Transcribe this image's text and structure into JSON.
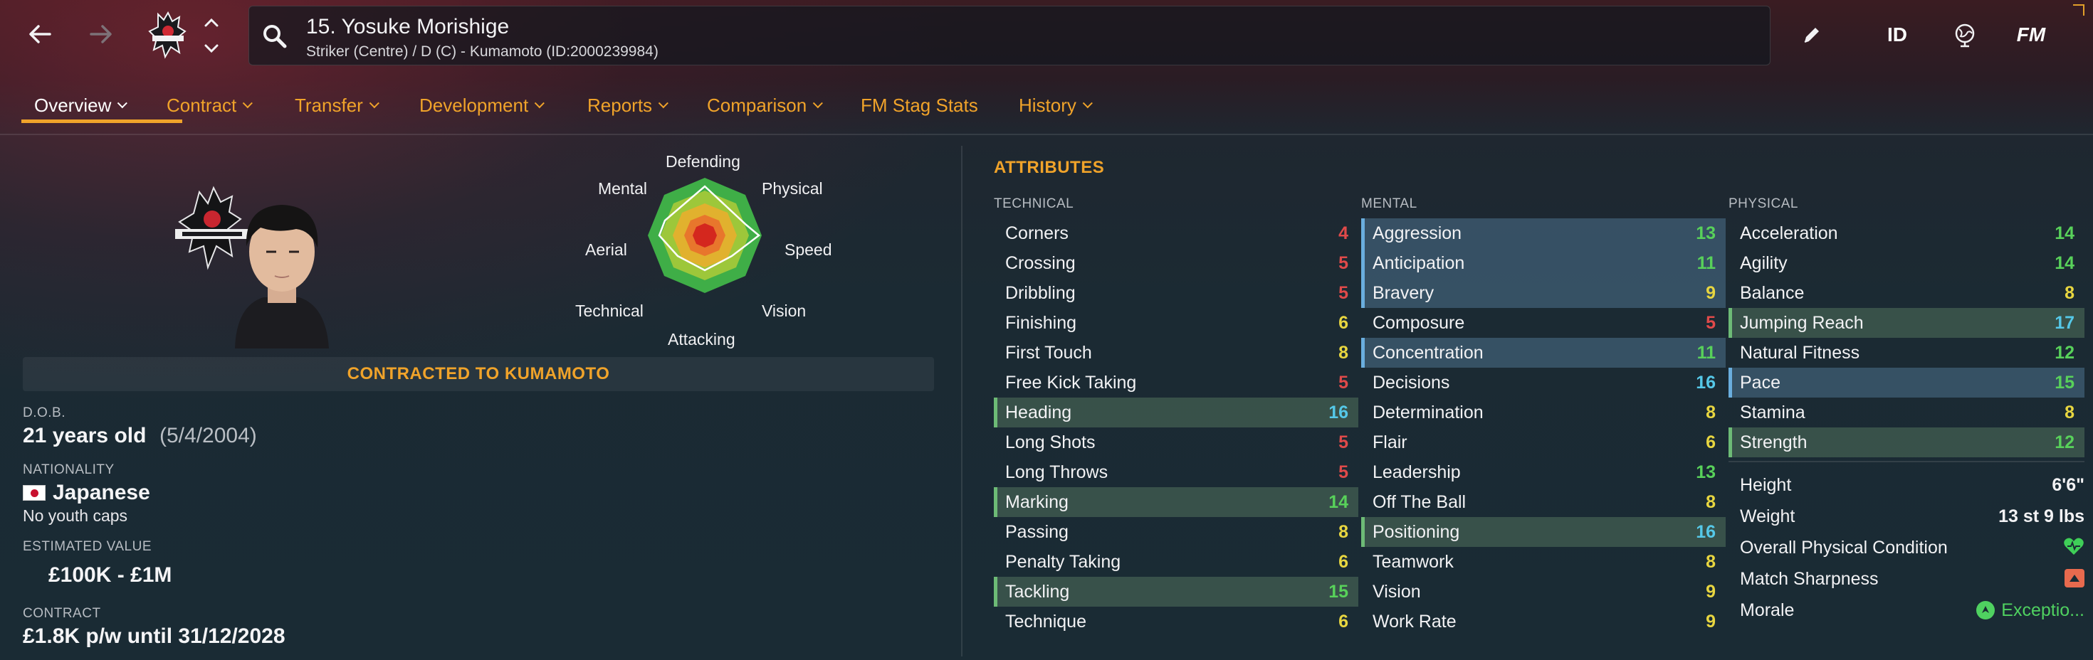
{
  "header": {
    "player_name": "15. Yosuke Morishige",
    "player_subtitle": "Striker (Centre) / D (C) - Kumamoto (ID:2000239984)",
    "id_label": "ID",
    "fm_label": "FM"
  },
  "tabs": [
    {
      "label": "Overview",
      "active": true
    },
    {
      "label": "Contract"
    },
    {
      "label": "Transfer"
    },
    {
      "label": "Development"
    },
    {
      "label": "Reports"
    },
    {
      "label": "Comparison"
    },
    {
      "label": "FM Stag Stats"
    },
    {
      "label": "History"
    }
  ],
  "radar": {
    "labels": {
      "defending": "Defending",
      "physical": "Physical",
      "speed": "Speed",
      "vision": "Vision",
      "attacking": "Attacking",
      "technical": "Technical",
      "aerial": "Aerial",
      "mental": "Mental"
    }
  },
  "profile": {
    "contract_banner": "CONTRACTED TO KUMAMOTO",
    "dob_label": "D.O.B.",
    "age": "21 years old",
    "dob": "(5/4/2004)",
    "nationality_label": "NATIONALITY",
    "nationality": "Japanese",
    "youth_caps": "No youth caps",
    "value_label": "ESTIMATED VALUE",
    "value": "£100K - £1M",
    "contract_label": "CONTRACT",
    "contract": "£1.8K p/w until 31/12/2028"
  },
  "attributes": {
    "title": "ATTRIBUTES",
    "technical": {
      "heading": "TECHNICAL",
      "items": [
        {
          "name": "Corners",
          "value": "4"
        },
        {
          "name": "Crossing",
          "value": "5"
        },
        {
          "name": "Dribbling",
          "value": "5"
        },
        {
          "name": "Finishing",
          "value": "6"
        },
        {
          "name": "First Touch",
          "value": "8"
        },
        {
          "name": "Free Kick Taking",
          "value": "5"
        },
        {
          "name": "Heading",
          "value": "16",
          "hl": "green"
        },
        {
          "name": "Long Shots",
          "value": "5"
        },
        {
          "name": "Long Throws",
          "value": "5"
        },
        {
          "name": "Marking",
          "value": "14",
          "hl": "green"
        },
        {
          "name": "Passing",
          "value": "8"
        },
        {
          "name": "Penalty Taking",
          "value": "6"
        },
        {
          "name": "Tackling",
          "value": "15",
          "hl": "green"
        },
        {
          "name": "Technique",
          "value": "6"
        }
      ]
    },
    "mental": {
      "heading": "MENTAL",
      "items": [
        {
          "name": "Aggression",
          "value": "13",
          "hl": "blue"
        },
        {
          "name": "Anticipation",
          "value": "11",
          "hl": "blue"
        },
        {
          "name": "Bravery",
          "value": "9",
          "hl": "blue"
        },
        {
          "name": "Composure",
          "value": "5"
        },
        {
          "name": "Concentration",
          "value": "11",
          "hl": "blue"
        },
        {
          "name": "Decisions",
          "value": "16"
        },
        {
          "name": "Determination",
          "value": "8"
        },
        {
          "name": "Flair",
          "value": "6"
        },
        {
          "name": "Leadership",
          "value": "13"
        },
        {
          "name": "Off The Ball",
          "value": "8"
        },
        {
          "name": "Positioning",
          "value": "16",
          "hl": "green"
        },
        {
          "name": "Teamwork",
          "value": "8"
        },
        {
          "name": "Vision",
          "value": "9"
        },
        {
          "name": "Work Rate",
          "value": "9"
        }
      ]
    },
    "physical": {
      "heading": "PHYSICAL",
      "items": [
        {
          "name": "Acceleration",
          "value": "14"
        },
        {
          "name": "Agility",
          "value": "14"
        },
        {
          "name": "Balance",
          "value": "8"
        },
        {
          "name": "Jumping Reach",
          "value": "17",
          "hl": "green"
        },
        {
          "name": "Natural Fitness",
          "value": "12"
        },
        {
          "name": "Pace",
          "value": "15",
          "hl": "blue"
        },
        {
          "name": "Stamina",
          "value": "8"
        },
        {
          "name": "Strength",
          "value": "12",
          "hl": "green"
        }
      ]
    },
    "physical_extra": {
      "height_label": "Height",
      "height": "6'6\"",
      "weight_label": "Weight",
      "weight": "13 st 9 lbs",
      "condition_label": "Overall Physical Condition",
      "sharpness_label": "Match Sharpness",
      "morale_label": "Morale",
      "morale": "Exceptio..."
    }
  },
  "colors": {
    "accent": "#f0a32a",
    "val_red": "#e04a4a",
    "val_yellow": "#e8d640",
    "val_green": "#58d15a",
    "val_blue": "#55c8e8"
  }
}
